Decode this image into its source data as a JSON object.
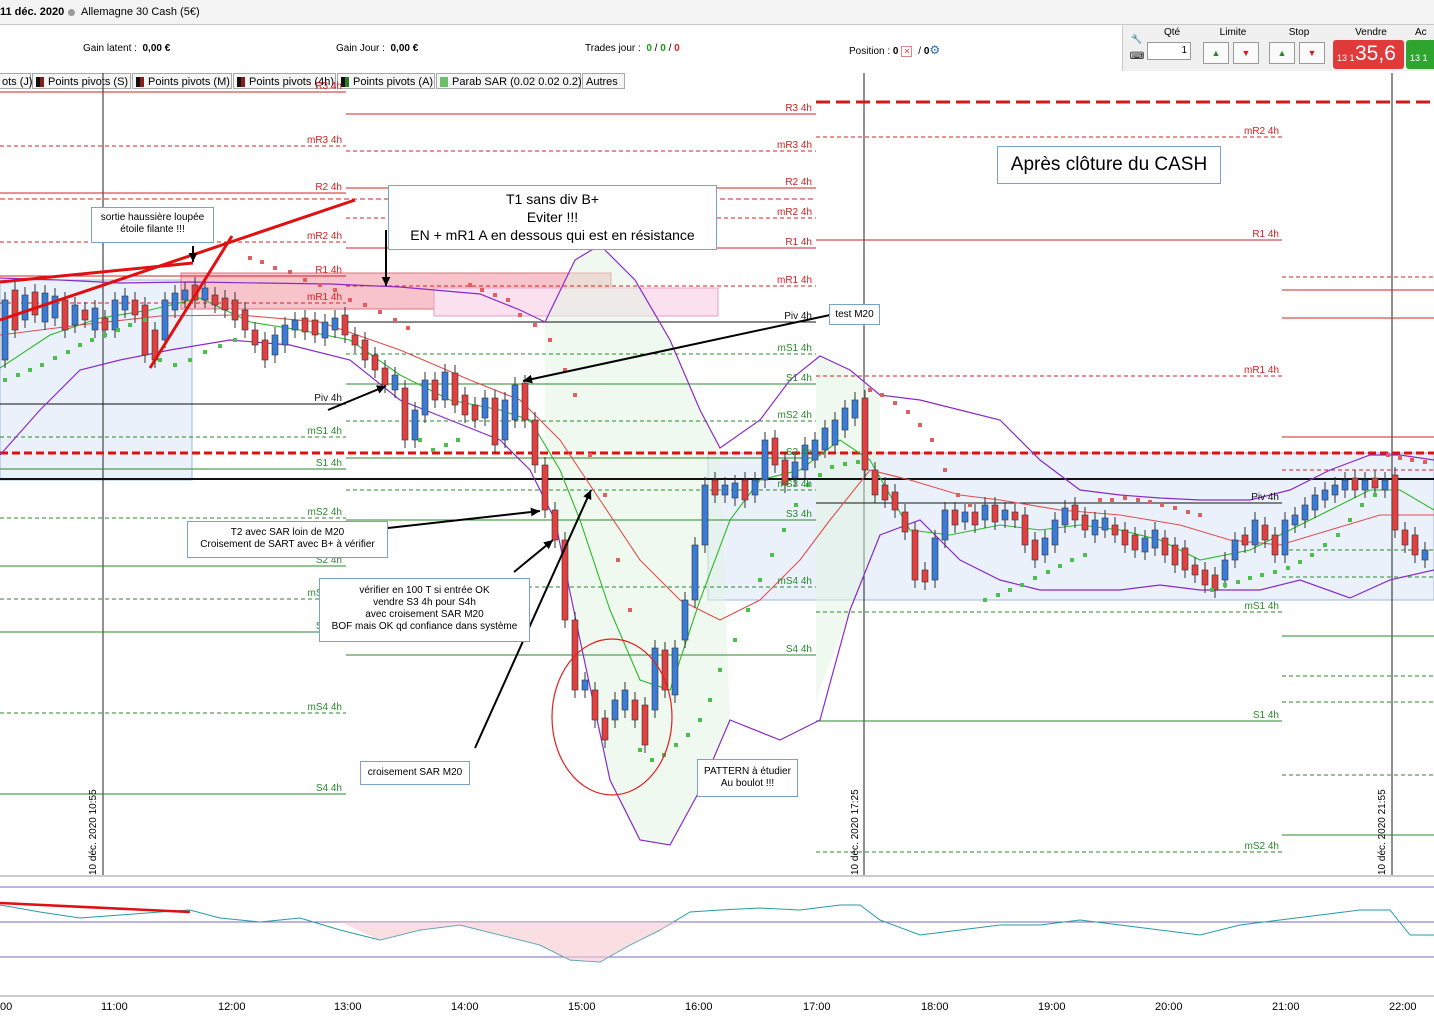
{
  "header": {
    "date": "11 déc. 2020",
    "instrument": "Allemagne 30 Cash (5€)"
  },
  "account": {
    "gain_latent_label": "Gain latent :",
    "gain_latent_value": "0,00 €",
    "gain_jour_label": "Gain Jour :",
    "gain_jour_value": "0,00 €",
    "trades_jour_label": "Trades jour :",
    "trades_a": "0",
    "trades_b": "0",
    "trades_c": "0",
    "position_label": "Position :",
    "position_value": "0",
    "position_sep": "/",
    "position_value2": "0"
  },
  "trade_panel": {
    "qty_label": "Qté",
    "qty_value": "1",
    "limit_label": "Limite",
    "stop_label": "Stop",
    "sell_label": "Vendre",
    "sell_small": "13 1",
    "sell_big": "35,6",
    "buy_label": "Ac",
    "buy_small": "13 1"
  },
  "indicator_tabs": [
    {
      "label": "ots (J)",
      "color": "#1a1a1a"
    },
    {
      "label": "Points pivots (S)",
      "color": "#8b1a1a"
    },
    {
      "label": "Points pivots (M)",
      "color": "#8b1a1a"
    },
    {
      "label": "Points pivots (4h)",
      "color": "#8b1a1a"
    },
    {
      "label": "Points pivots (A)",
      "color": "#1a1a1a"
    },
    {
      "label": "Parab SAR (0.02 0.02 0.2)",
      "color": "#6bbf6b"
    },
    {
      "label": "Autres",
      "color": ""
    }
  ],
  "pivot_labels": {
    "left": [
      "R3 4h",
      "mR3 4h",
      "R2 4h",
      "mR2 4h",
      "R1 4h",
      "mR1 4h",
      "Piv 4h",
      "mS1 4h",
      "S1 4h",
      "mS2 4h",
      "S2 4h",
      "mS3 4h",
      "S3 4h",
      "mS4 4h",
      "S4 4h"
    ],
    "middle": [
      "R3 4h",
      "mR3 4h",
      "R2 4h",
      "mR2 4h",
      "R1 4h",
      "mR1 4h",
      "Piv 4h",
      "mS1 4h",
      "S1 4h",
      "mS2 4h",
      "S2 4h",
      "mS3 4h",
      "S3 4h",
      "mS4 4h",
      "S4 4h"
    ],
    "right": [
      "mR2 4h",
      "R1 4h",
      "mR1 4h",
      "Piv 4h",
      "mS1 4h",
      "S1 4h",
      "mS2 4h"
    ]
  },
  "annotations": {
    "sortie": [
      "sortie haussière loupée",
      "étoile filante !!!"
    ],
    "t1": [
      "T1 sans div B+",
      "Eviter !!!",
      "EN + mR1 A en dessous qui est en résistance"
    ],
    "test": "test M20",
    "apres": "Après clôture du CASH",
    "t2": [
      "T2 avec SAR loin de M20",
      "Croisement de SART avec B+ à vérifier"
    ],
    "verifier": [
      "vérifier en 100 T si entrée OK",
      "vendre S3 4h pour S4h",
      "avec croisement SAR M20",
      "BOF mais OK qd confiance dans système"
    ],
    "croisement": "croisement SAR M20",
    "pattern": [
      "PATTERN à étudier",
      "Au boulot !!!"
    ]
  },
  "date_separators": [
    "10 déc. 2020 10:55",
    "10 déc. 2020 17:25",
    "10 déc. 2020 21:55"
  ],
  "time_axis": [
    "00",
    "11:00",
    "12:00",
    "13:00",
    "14:00",
    "15:00",
    "16:00",
    "17:00",
    "18:00",
    "19:00",
    "20:00",
    "21:00",
    "22:00"
  ],
  "colors": {
    "bull_candle": "#3a7bd5",
    "bear_candle": "#e04040",
    "pivot_red": "#d42020",
    "pivot_green": "#2a8a2a",
    "sar": "#e06060",
    "sar_bull": "#4cc04c",
    "bollinger": "#8a2bc9",
    "ma20": "#2db82d"
  }
}
